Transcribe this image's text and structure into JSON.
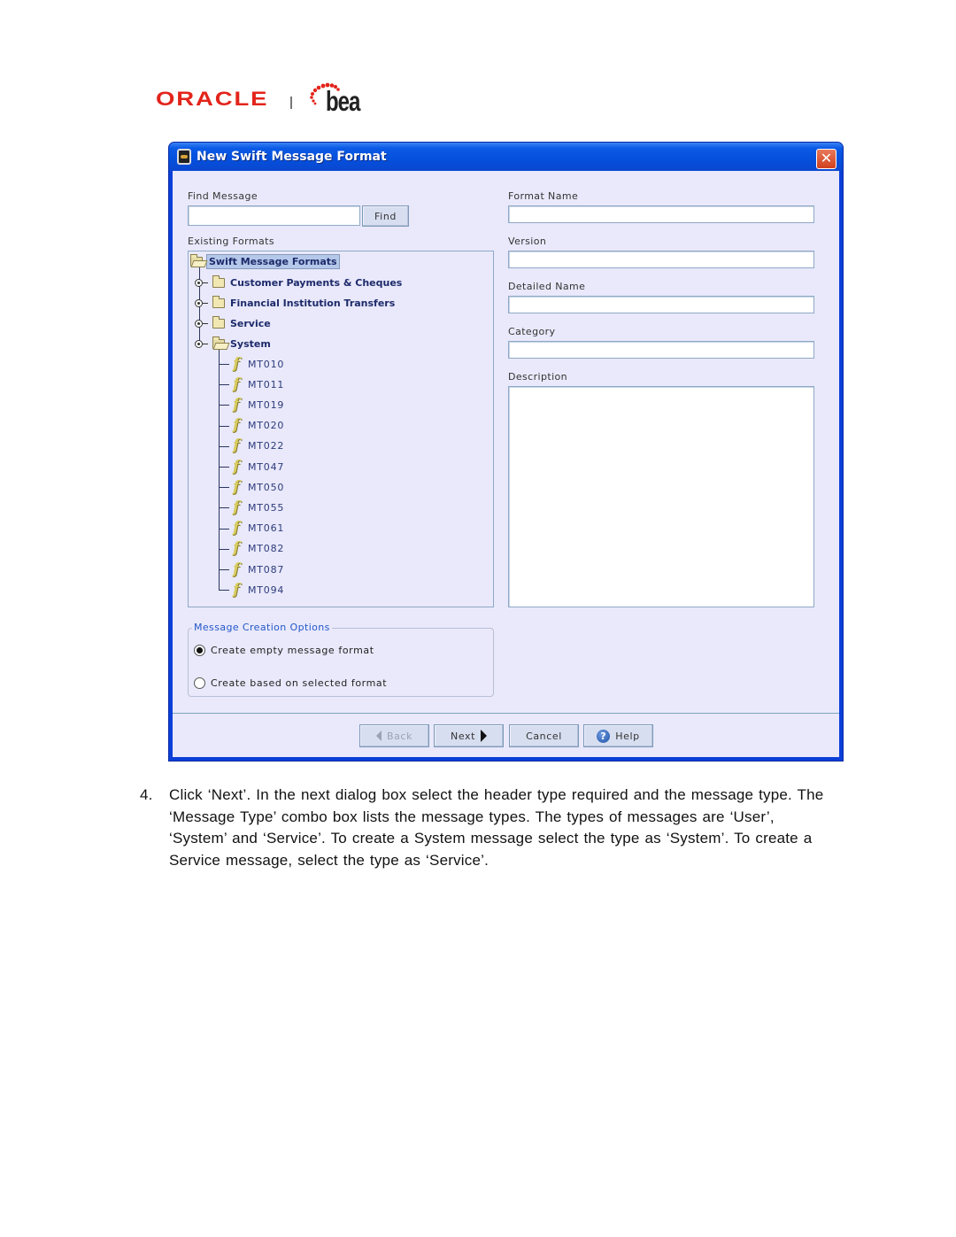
{
  "logo": {
    "oracle": "ORACLE",
    "bea": "bea"
  },
  "dialog": {
    "title": "New Swift Message Format",
    "close_label": "✕",
    "find": {
      "label": "Find Message",
      "value": "",
      "button": "Find"
    },
    "existing_formats": {
      "label": "Existing Formats",
      "root": "Swift Message Formats",
      "folders": [
        {
          "label": "Customer Payments & Cheques",
          "expanded": false
        },
        {
          "label": "Financial Institution Transfers",
          "expanded": false
        },
        {
          "label": "Service",
          "expanded": false
        },
        {
          "label": "System",
          "expanded": true
        }
      ],
      "system_items": [
        "MT010",
        "MT011",
        "MT019",
        "MT020",
        "MT022",
        "MT047",
        "MT050",
        "MT055",
        "MT061",
        "MT082",
        "MT087",
        "MT094"
      ]
    },
    "fields": {
      "format_name": {
        "label": "Format Name",
        "value": ""
      },
      "version": {
        "label": "Version",
        "value": ""
      },
      "detailed_name": {
        "label": "Detailed Name",
        "value": ""
      },
      "category": {
        "label": "Category",
        "value": ""
      },
      "description": {
        "label": "Description",
        "value": ""
      }
    },
    "creation_options": {
      "title": "Message Creation Options",
      "options": [
        {
          "label": "Create empty message format",
          "checked": true
        },
        {
          "label": "Create based on selected format",
          "checked": false
        }
      ]
    },
    "buttons": {
      "back": "Back",
      "next": "Next",
      "cancel": "Cancel",
      "help": "Help"
    }
  },
  "document": {
    "step_number": "4.",
    "text": "Click ‘Next’. In the next dialog box select the header type required and the message type. The ‘Message Type’ combo box lists the message types. The types of messages are ‘User’, ‘System’ and ‘Service’. To create a System message select the type as ‘System’. To create a Service message, select the type as ‘Service’."
  }
}
